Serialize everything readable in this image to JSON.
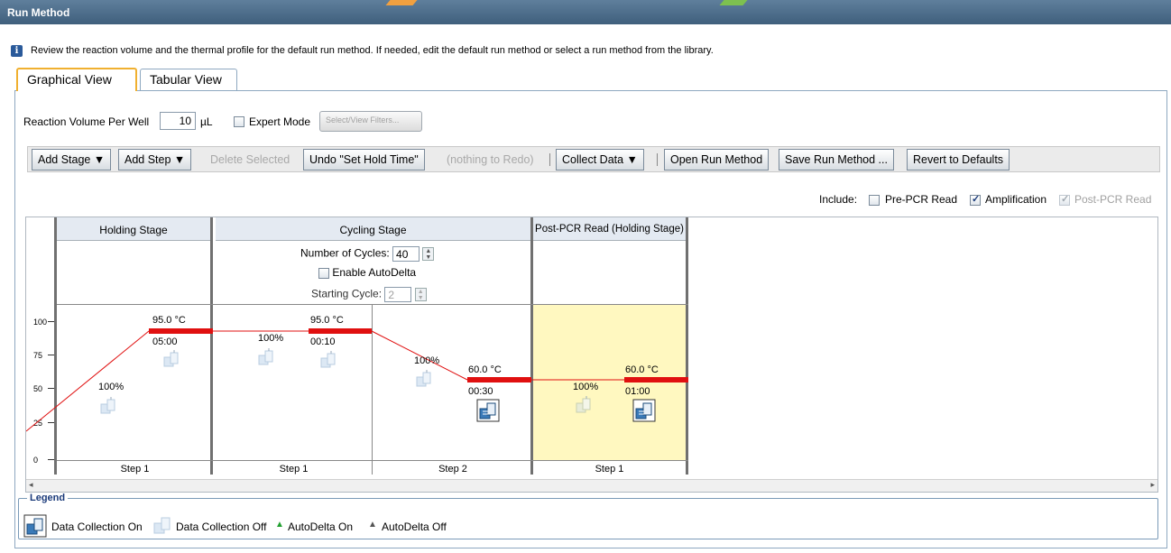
{
  "window": {
    "title": "Run Method"
  },
  "info": {
    "text": "Review the reaction volume and the thermal profile for the default run method. If needed, edit the default run method or select a run method from the library."
  },
  "tabs": [
    {
      "label": "Graphical View",
      "active": true
    },
    {
      "label": "Tabular View",
      "active": false
    }
  ],
  "settings": {
    "reaction_volume_label": "Reaction Volume Per Well",
    "reaction_volume_value": "10",
    "reaction_volume_unit": "µL",
    "expert_mode_label": "Expert Mode",
    "filters_button": "Select/View Filters..."
  },
  "toolbar": {
    "add_stage": "Add Stage ▼",
    "add_step": "Add Step ▼",
    "delete_selected": "Delete Selected",
    "undo": "Undo \"Set Hold Time\"",
    "redo": "(nothing to Redo)",
    "collect_data": "Collect Data ▼",
    "open_run_method": "Open Run Method",
    "save_run_method": "Save Run Method ...",
    "revert_defaults": "Revert to Defaults"
  },
  "include": {
    "label": "Include:",
    "pre_pcr": "Pre-PCR Read",
    "amplification": "Amplification",
    "post_pcr": "Post-PCR Read"
  },
  "graph": {
    "y_ticks": [
      "100",
      "75",
      "50",
      "25",
      "0"
    ],
    "stages": [
      {
        "name": "Holding Stage"
      },
      {
        "name": "Cycling Stage",
        "cycles_label": "Number of Cycles:",
        "cycles_value": "40",
        "autodelta_label": "Enable AutoDelta",
        "starting_cycle_label": "Starting Cycle:",
        "starting_cycle_value": "2"
      },
      {
        "name": "Post-PCR Read (Holding Stage)"
      }
    ],
    "steps": [
      {
        "label": "Step 1",
        "temp": "95.0 °C",
        "time": "05:00",
        "ramp": "100%"
      },
      {
        "label": "Step 1",
        "temp": "95.0 °C",
        "time": "00:10",
        "ramp": "100%"
      },
      {
        "label": "Step 2",
        "temp": "60.0 °C",
        "time": "00:30",
        "ramp": "100%"
      },
      {
        "label": "Step 1",
        "temp": "60.0 °C",
        "time": "01:00",
        "ramp": "100%"
      }
    ]
  },
  "legend": {
    "title": "Legend",
    "dc_on": "Data Collection On",
    "dc_off": "Data Collection Off",
    "ad_on": "AutoDelta On",
    "ad_off": "AutoDelta Off"
  },
  "colors": {
    "title_bar": "#4f6f8c",
    "profile_line": "#e01010",
    "post_pcr_bg": "#fff8c0",
    "tab_active_border": "#f0b030"
  }
}
